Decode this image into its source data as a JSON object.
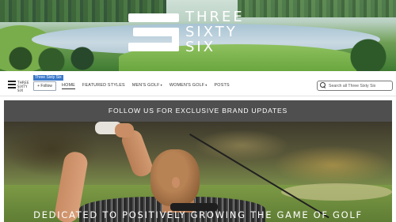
{
  "hero": {
    "brand_name": "THREE SIXTY SIX"
  },
  "navbar": {
    "small_logo_text_line1": "THREE",
    "small_logo_text_line2": "SIXTY SIX",
    "brand_tag": "Three Sixty Six",
    "follow_label": "+ Follow",
    "links": [
      {
        "label": "HOME",
        "active": true
      },
      {
        "label": "FEATURED STYLES",
        "active": false
      },
      {
        "label": "MEN'S GOLF",
        "dropdown": true
      },
      {
        "label": "WOMEN'S GOLF",
        "dropdown": true
      },
      {
        "label": "POSTS",
        "active": false
      }
    ],
    "caret_glyph": "▾",
    "search_placeholder": "Search all Three Sixty Six"
  },
  "promo": {
    "banner_text": "FOLLOW US FOR EXCLUSIVE BRAND UPDATES",
    "tagline": "DEDICATED TO POSITIVELY GROWING THE GAME OF GOLF"
  },
  "colors": {
    "banner_bg": "#4f4f4f",
    "brand_tag_bg": "#3a78c9"
  }
}
